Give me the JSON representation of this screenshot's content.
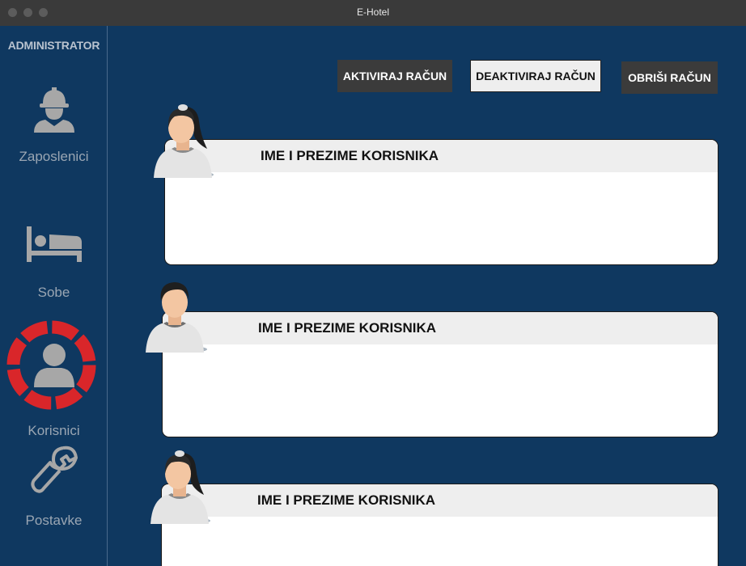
{
  "window": {
    "title": "E-Hotel"
  },
  "sidebar": {
    "role_label": "ADMINISTRATOR",
    "items": [
      {
        "label": "Zaposlenici",
        "icon": "worker-icon",
        "selected": false
      },
      {
        "label": "Sobe",
        "icon": "bed-icon",
        "selected": false
      },
      {
        "label": "Korisnici",
        "icon": "user-icon",
        "selected": true
      },
      {
        "label": "Postavke",
        "icon": "wrench-icon",
        "selected": false
      }
    ],
    "selected_color": "#d9262a"
  },
  "toolbar": {
    "activate_label": "AKTIVIRAJ RAČUN",
    "deactivate_label": "DEAKTIVIRAJ RAČUN",
    "delete_label": "OBRIŠI RAČUN"
  },
  "users": [
    {
      "name": "IME I PREZIME KORISNIKA",
      "avatar": "female-avatar-icon"
    },
    {
      "name": "IME I PREZIME KORISNIKA",
      "avatar": "male-avatar-icon"
    },
    {
      "name": "IME I PREZIME KORISNIKA",
      "avatar": "female-avatar-icon"
    }
  ]
}
